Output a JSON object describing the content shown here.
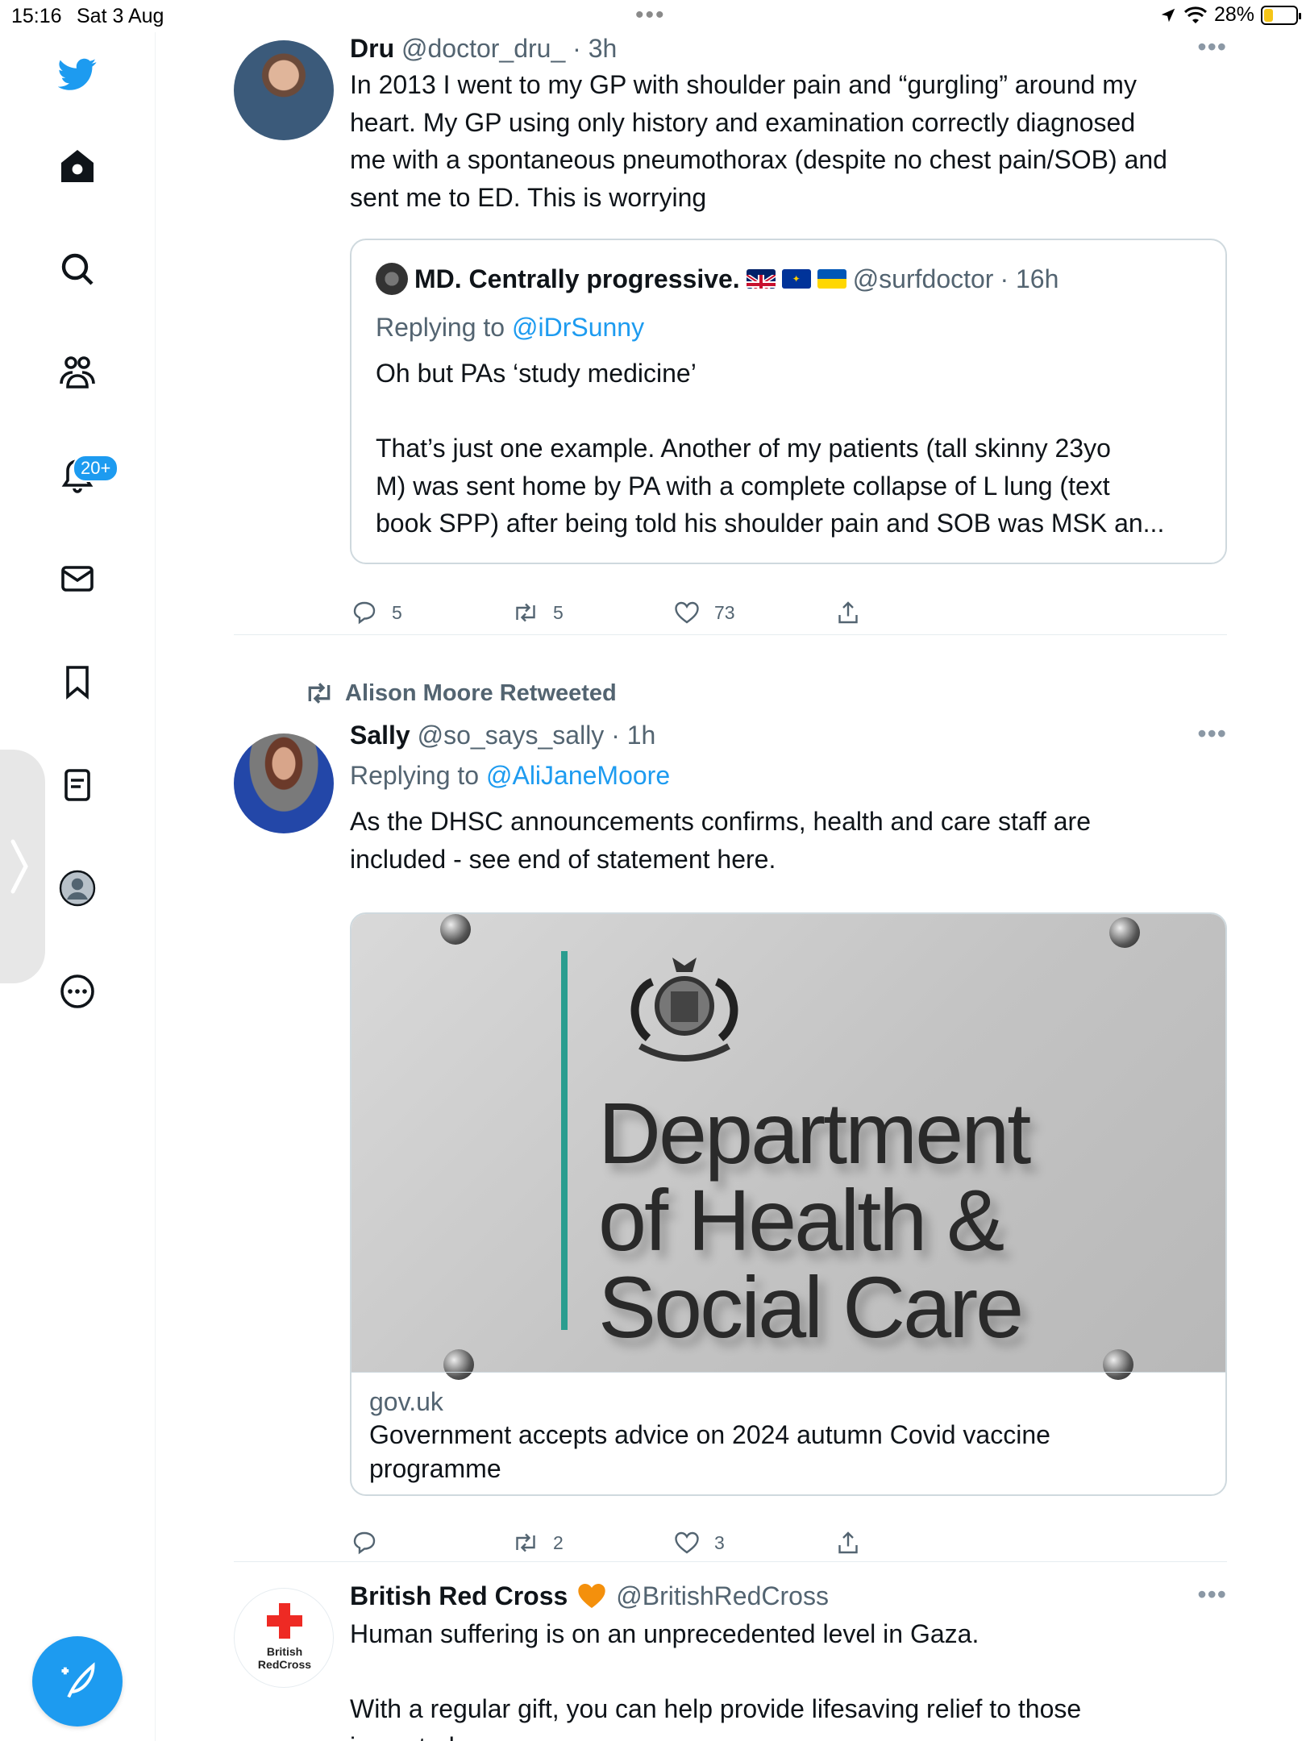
{
  "status_bar": {
    "time": "15:16",
    "date": "Sat 3 Aug",
    "battery": "28%",
    "battery_level": 0.28
  },
  "sidebar": {
    "notifications_badge": "20+"
  },
  "tweets": [
    {
      "name": "Dru",
      "handle": "@doctor_dru_",
      "time": "· 3h",
      "text": "In 2013 I went to my GP with shoulder pain and “gurgling” around my\nheart. My GP using only history and examination correctly diagnosed\nme with a spontaneous pneumothorax (despite no chest pain/SOB) and\nsent me to ED. This is worrying",
      "quote": {
        "name": "MD. Centrally progressive.",
        "handle": "@surfdoctor",
        "time": "· 16h",
        "replying_prefix": "Replying to ",
        "replying_to": "@iDrSunny",
        "text": "Oh but PAs ‘study medicine’\n\nThat’s just one example. Another of my patients (tall skinny 23yo\nM) was sent home by PA with a complete collapse of L lung (text\nbook SPP) after being told his shoulder pain and SOB was MSK an..."
      },
      "replies": "5",
      "retweets": "5",
      "likes": "73"
    },
    {
      "retweeted_by": "Alison Moore Retweeted",
      "name": "Sally",
      "handle": "@so_says_sally",
      "time": "· 1h",
      "replying_prefix": "Replying to ",
      "replying_to": "@AliJaneMoore",
      "text": "As the DHSC announcements confirms, health and care staff are\nincluded - see end of statement here.",
      "card": {
        "image_text": "Department\nof Health &\nSocial Care",
        "domain": "gov.uk",
        "title": "Government accepts advice on 2024 autumn Covid vaccine\nprogramme"
      },
      "replies": "",
      "retweets": "2",
      "likes": "3"
    },
    {
      "name": "British Red Cross",
      "handle": "@BritishRedCross",
      "avatar_text": "British\nRedCross",
      "text": "Human suffering is on an unprecedented level in Gaza.\n\nWith a regular gift, you can help provide lifesaving relief to those\nimpacted."
    }
  ],
  "colors": {
    "accent": "#1d9bf0",
    "text": "#0f1419",
    "muted": "#536471"
  }
}
